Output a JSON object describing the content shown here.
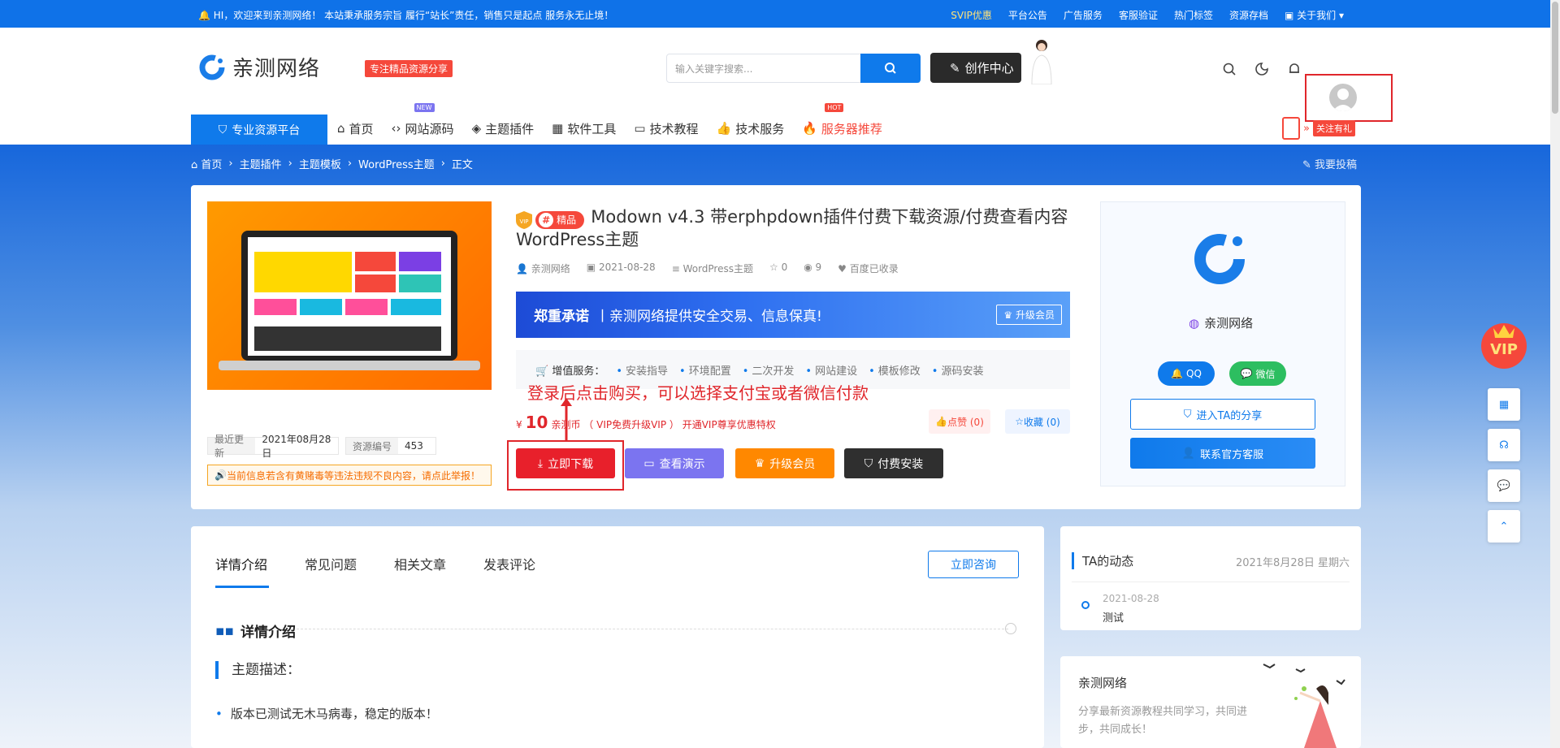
{
  "topbar": {
    "welcome": "HI，欢迎来到亲测网络！ 本站秉承服务宗旨 履行“站长”责任，销售只是起点 服务永无止境！",
    "links": [
      "SVIP优惠",
      "平台公告",
      "广告服务",
      "客服验证",
      "热门标签",
      "资源存档",
      "关于我们"
    ]
  },
  "header": {
    "logo_text": "亲测网络",
    "logo_tag": "专注精品资源分享",
    "search_placeholder": "输入关键字搜索...",
    "create_label": "创作中心"
  },
  "nav": {
    "platform": "专业资源平台",
    "items": [
      {
        "label": "首页",
        "icon": "home-icon"
      },
      {
        "label": "网站源码",
        "icon": "code-icon",
        "badge": "NEW"
      },
      {
        "label": "主题插件",
        "icon": "layers-icon"
      },
      {
        "label": "软件工具",
        "icon": "grid-icon"
      },
      {
        "label": "技术教程",
        "icon": "monitor-icon"
      },
      {
        "label": "技术服务",
        "icon": "thumb-icon"
      },
      {
        "label": "服务器推荐",
        "icon": "fire-icon",
        "badge": "HOT"
      }
    ],
    "follow": "关注有礼"
  },
  "breadcrumb": [
    "首页",
    "主题插件",
    "主题模板",
    "WordPress主题",
    "正文"
  ],
  "submit_link": "我要投稿",
  "product": {
    "jing": "精品",
    "title": "Modown v4.3 带erphpdown插件付费下载资源/付费查看内容 WordPress主题",
    "meta": {
      "author": "亲测网络",
      "date": "2021-08-28",
      "category": "WordPress主题",
      "stars": "0",
      "views": "9",
      "baidu": "百度已收录"
    },
    "banner_bold": "郑重承诺",
    "banner_text": "丨亲测网络提供安全交易、信息保真!",
    "banner_btn": "升级会员",
    "services_label": "增值服务：",
    "services": [
      "安装指导",
      "环境配置",
      "二次开发",
      "网站建设",
      "模板修改",
      "源码安装"
    ],
    "annotation": "登录后点击购买，可以选择支付宝或者微信付款",
    "price_symbol": "¥",
    "price": "10",
    "price_note": "亲测币 （ VIP免费升级VIP ） 开通VIP尊享优惠特权",
    "like": "点赞 (0)",
    "fav": "收藏 (0)",
    "btn_download": "立即下载",
    "btn_demo": "查看演示",
    "btn_upgrade": "升级会员",
    "btn_install": "付费安装",
    "update_label": "最近更新",
    "update_value": "2021年08月28日",
    "id_label": "资源编号",
    "id_value": "453",
    "report": "当前信息若含有黄赌毒等违法违规不良内容，请点此举报！"
  },
  "author": {
    "name": "亲测网络",
    "qq": "QQ",
    "wechat": "微信",
    "share": "进入TA的分享",
    "contact": "联系官方客服"
  },
  "content": {
    "tabs": [
      "详情介绍",
      "常见问题",
      "相关文章",
      "发表评论"
    ],
    "consult": "立即咨询",
    "section_title": "详情介绍",
    "subheading": "主题描述：",
    "bullet": "版本已测试无木马病毒，稳定的版本！"
  },
  "dynamics": {
    "title": "TA的动态",
    "date": "2021年8月28日 星期六",
    "item_date": "2021-08-28",
    "item_text": "测试"
  },
  "about": {
    "title": "亲测网络",
    "desc": "分享最新资源教程共同学习，共同进步，共同成长！"
  },
  "colors": {
    "primary": "#0f72e8",
    "red": "#f5483b",
    "orange": "#ff8800",
    "purple": "#7b74f0",
    "dark": "#2f2f2f"
  }
}
